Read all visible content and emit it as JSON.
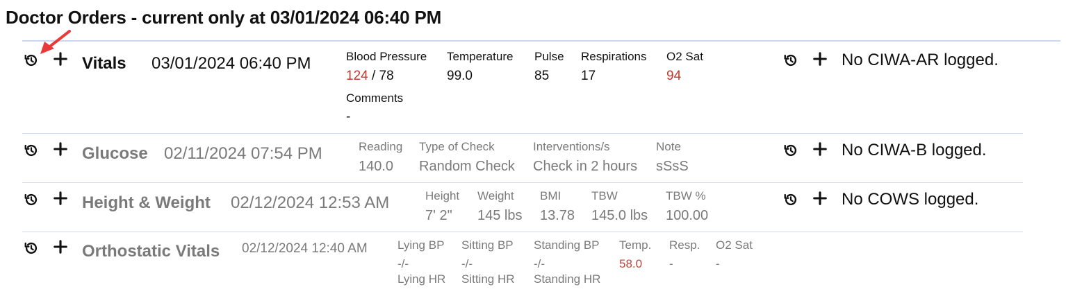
{
  "page": {
    "title": "Doctor Orders - current only at 03/01/2024 06:40 PM"
  },
  "icons": {
    "history": "history-icon",
    "add": "plus-icon",
    "pointer": "red-arrow-pointer"
  },
  "colors": {
    "abnormal": "#c0392b",
    "muted": "#7a7a7a",
    "divider": "#c9d8f2"
  },
  "vitals": {
    "name": "Vitals",
    "datetime": "03/01/2024 06:40 PM",
    "bp_label": "Blood Pressure",
    "bp_sys": "124",
    "bp_sep": " / ",
    "bp_dia": "78",
    "temp_label": "Temperature",
    "temp": "99.0",
    "pulse_label": "Pulse",
    "pulse": "85",
    "resp_label": "Respirations",
    "resp": "17",
    "o2_label": "O2 Sat",
    "o2": "94",
    "comments_label": "Comments",
    "comments": "-"
  },
  "glucose": {
    "name": "Glucose",
    "datetime": "02/11/2024 07:54 PM",
    "reading_label": "Reading",
    "reading": "140.0",
    "type_label": "Type of Check",
    "type": "Random Check",
    "interv_label": "Interventions/s",
    "interv": "Check in 2 hours",
    "note_label": "Note",
    "note": "sSsS"
  },
  "height_weight": {
    "name": "Height & Weight",
    "datetime": "02/12/2024 12:53 AM",
    "height_label": "Height",
    "height": "7' 2\"",
    "weight_label": "Weight",
    "weight": "145 lbs",
    "bmi_label": "BMI",
    "bmi": "13.78",
    "tbw_label": "TBW",
    "tbw": "145.0 lbs",
    "tbwp_label": "TBW %",
    "tbwp": "100.00"
  },
  "orthostatic": {
    "name": "Orthostatic Vitals",
    "datetime": "02/12/2024 12:40 AM",
    "lying_bp_label": "Lying BP",
    "lying_bp": "-/-",
    "lying_hr_label": "Lying HR",
    "sitting_bp_label": "Sitting BP",
    "sitting_bp": "-/-",
    "sitting_hr_label": "Sitting HR",
    "standing_bp_label": "Standing BP",
    "standing_bp": "-/-",
    "standing_hr_label": "Standing HR",
    "temp_label": "Temp.",
    "temp": "58.0",
    "resp_label": "Resp.",
    "resp": "-",
    "o2_label": "O2 Sat",
    "o2": "-"
  },
  "assessments": {
    "ciwa_ar": "No CIWA-AR logged.",
    "ciwa_b": "No CIWA-B logged.",
    "cows": "No COWS logged."
  }
}
